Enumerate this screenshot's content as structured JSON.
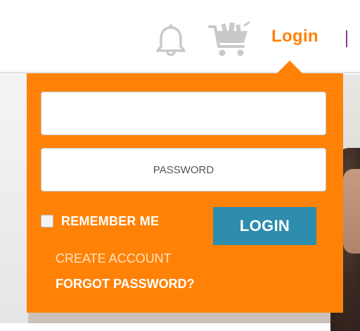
{
  "header": {
    "login_label": "Login",
    "icons": {
      "notifications": "bell-icon",
      "cart": "shopping-cart-icon"
    }
  },
  "login_panel": {
    "username_placeholder": "",
    "password_placeholder": "PASSWORD",
    "remember_label": "REMEMBER ME",
    "remember_checked": false,
    "submit_label": "LOGIN",
    "create_account_label": "CREATE ACCOUNT",
    "forgot_password_label": "FORGOT PASSWORD?"
  },
  "colors": {
    "accent": "#ff8207",
    "button": "#2e8cad",
    "icon_gray": "#c9c9c9",
    "divider": "#8a3a8f"
  }
}
